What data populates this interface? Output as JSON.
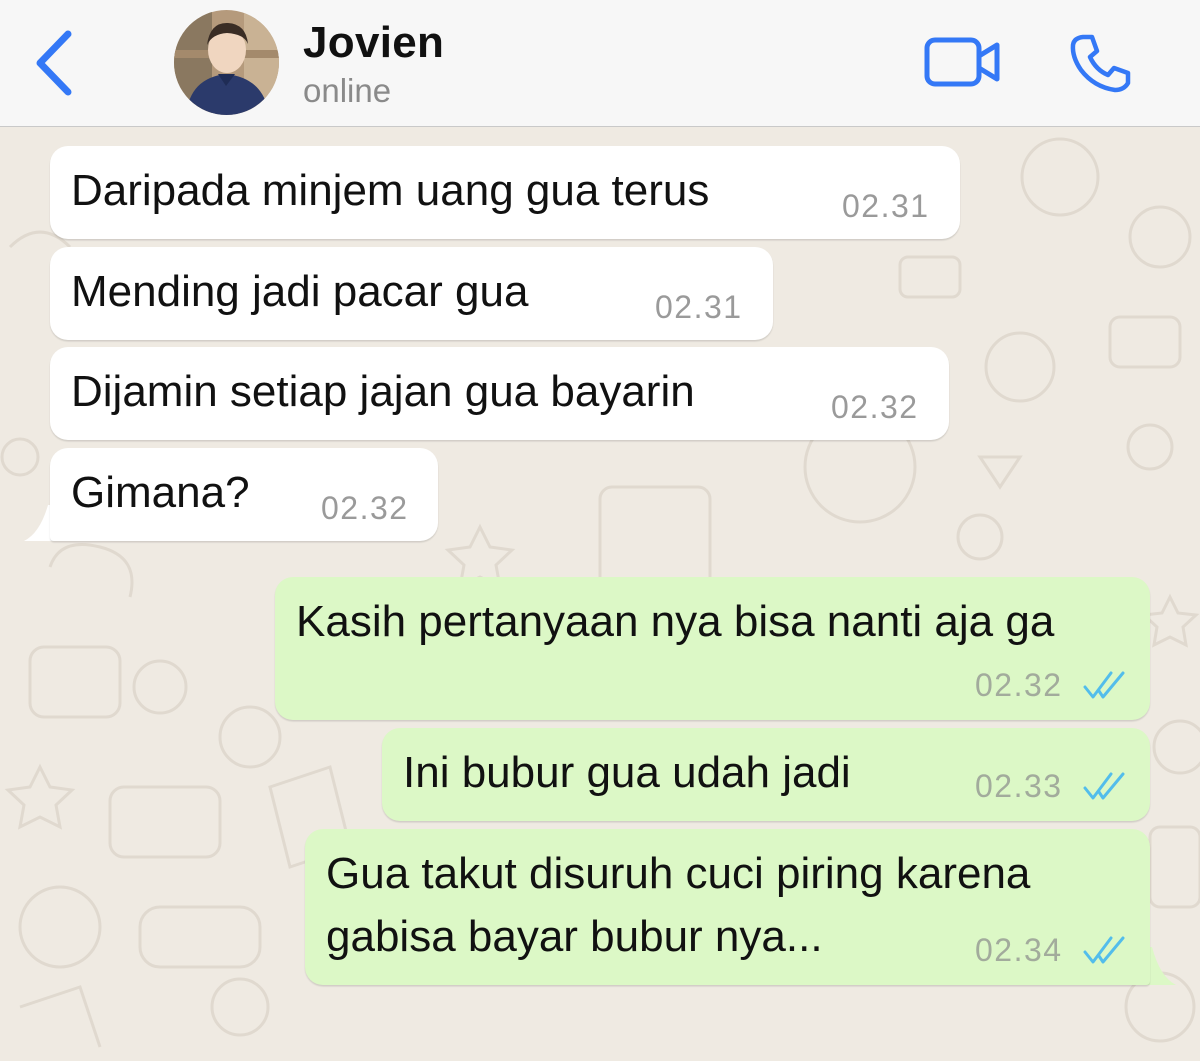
{
  "header": {
    "contact_name": "Jovien",
    "status": "online",
    "back_icon": "chevron-left-icon",
    "video_icon": "video-camera-icon",
    "call_icon": "phone-icon",
    "accent_color": "#3478f6"
  },
  "colors": {
    "incoming_bubble": "#ffffff",
    "outgoing_bubble": "#dcf8c6",
    "read_ticks": "#53bdeb",
    "wallpaper": "#efeae2"
  },
  "messages": [
    {
      "direction": "incoming",
      "text": "Daripada minjem uang gua terus",
      "time": "02.31"
    },
    {
      "direction": "incoming",
      "text": "Mending jadi pacar gua",
      "time": "02.31"
    },
    {
      "direction": "incoming",
      "text": "Dijamin setiap jajan gua bayarin",
      "time": "02.32"
    },
    {
      "direction": "incoming",
      "text": "Gimana?",
      "time": "02.32"
    },
    {
      "direction": "outgoing",
      "text": "Kasih pertanyaan nya bisa nanti aja ga",
      "time": "02.32",
      "status": "read"
    },
    {
      "direction": "outgoing",
      "text": "Ini bubur gua udah jadi",
      "time": "02.33",
      "status": "read"
    },
    {
      "direction": "outgoing",
      "text_lines": [
        "Gua takut disuruh cuci piring karena",
        "gabisa bayar bubur nya..."
      ],
      "time": "02.34",
      "status": "read"
    }
  ]
}
